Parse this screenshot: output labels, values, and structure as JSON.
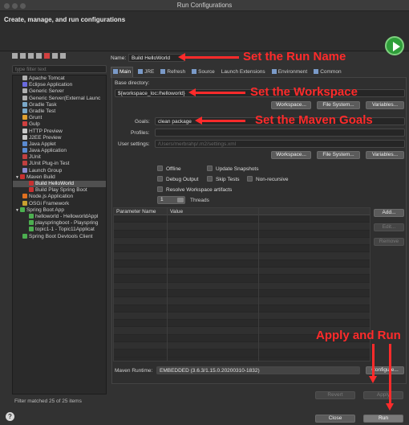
{
  "window": {
    "title": "Run Configurations"
  },
  "header": {
    "title": "Create, manage, and run configurations",
    "run_icon": "run-icon"
  },
  "sidebar": {
    "filter_placeholder": "type filter text",
    "items": [
      {
        "label": "Apache Tomcat",
        "icon": "server-icon",
        "color": "#b0b0b0",
        "indent": 1
      },
      {
        "label": "Eclipse Application",
        "icon": "eclipse-icon",
        "color": "#6a6adf",
        "indent": 1
      },
      {
        "label": "Generic Server",
        "icon": "server-icon",
        "color": "#b0b0b0",
        "indent": 1
      },
      {
        "label": "Generic Server(External Launc",
        "icon": "server-icon",
        "color": "#b0b0b0",
        "indent": 1
      },
      {
        "label": "Gradle Task",
        "icon": "gradle-icon",
        "color": "#7aa8c8",
        "indent": 1
      },
      {
        "label": "Gradle Test",
        "icon": "gradle-icon",
        "color": "#7aa8c8",
        "indent": 1
      },
      {
        "label": "Grunt",
        "icon": "grunt-icon",
        "color": "#e0a030",
        "indent": 1
      },
      {
        "label": "Gulp",
        "icon": "gulp-icon",
        "color": "#d04040",
        "indent": 1
      },
      {
        "label": "HTTP Preview",
        "icon": "preview-icon",
        "color": "#c8c8c8",
        "indent": 1
      },
      {
        "label": "J2EE Preview",
        "icon": "preview-icon",
        "color": "#c8c8c8",
        "indent": 1
      },
      {
        "label": "Java Applet",
        "icon": "applet-icon",
        "color": "#5a8ad0",
        "indent": 1
      },
      {
        "label": "Java Application",
        "icon": "java-icon",
        "color": "#5a8ad0",
        "indent": 1
      },
      {
        "label": "JUnit",
        "icon": "junit-icon",
        "color": "#c04040",
        "indent": 1
      },
      {
        "label": "JUnit Plug-in Test",
        "icon": "junit-icon",
        "color": "#c04040",
        "indent": 1
      },
      {
        "label": "Launch Group",
        "icon": "launch-group-icon",
        "color": "#8a8ad0",
        "indent": 1
      },
      {
        "label": "Maven Build",
        "icon": "maven-icon",
        "color": "#c83030",
        "indent": 0,
        "expanded": true
      },
      {
        "label": "Build HelloWorld",
        "icon": "maven-icon",
        "color": "#c83030",
        "indent": 2,
        "selected": true
      },
      {
        "label": "Build Play Spring Boot",
        "icon": "maven-icon",
        "color": "#c83030",
        "indent": 2
      },
      {
        "label": "Node.js Application",
        "icon": "nodejs-icon",
        "color": "#e07020",
        "indent": 1
      },
      {
        "label": "OSGi Framework",
        "icon": "osgi-icon",
        "color": "#c8a030",
        "indent": 1
      },
      {
        "label": "Spring Boot App",
        "icon": "spring-icon",
        "color": "#4caf50",
        "indent": 0,
        "expanded": true
      },
      {
        "label": "helloworld - HelloworldAppl",
        "icon": "spring-icon",
        "color": "#4caf50",
        "indent": 2
      },
      {
        "label": "playspringboot - Playspring",
        "icon": "spring-icon",
        "color": "#4caf50",
        "indent": 2
      },
      {
        "label": "topic1-1 - Topic11Applicat",
        "icon": "spring-icon",
        "color": "#4caf50",
        "indent": 2
      },
      {
        "label": "Spring Boot Devtools Client",
        "icon": "spring-icon",
        "color": "#4caf50",
        "indent": 1
      }
    ],
    "filter_status": "Filter matched 25 of 25 items"
  },
  "config": {
    "name_label": "Name:",
    "name_value": "Build HelloWorld",
    "tabs": [
      {
        "label": "Main",
        "icon": "main-tab-icon",
        "active": true
      },
      {
        "label": "JRE",
        "icon": "jre-icon"
      },
      {
        "label": "Refresh",
        "icon": "refresh-icon"
      },
      {
        "label": "Source",
        "icon": "source-icon"
      },
      {
        "label": "Launch Extensions",
        "icon": ""
      },
      {
        "label": "Environment",
        "icon": "environment-icon"
      },
      {
        "label": "Common",
        "icon": "common-icon"
      }
    ],
    "base_dir_label": "Base directory:",
    "base_dir_value": "${workspace_loc:/helloworld}",
    "workspace_btn": "Workspace...",
    "filesystem_btn": "File System...",
    "variables_btn": "Variables...",
    "goals_label": "Goals:",
    "goals_value": "clean package",
    "profiles_label": "Profiles:",
    "profiles_value": "",
    "user_settings_label": "User settings:",
    "user_settings_value": "/Users/merbrahp/.m2/settings.xml",
    "options": {
      "offline": "Offline",
      "update_snapshots": "Update Snapshots",
      "debug_output": "Debug Output",
      "skip_tests": "Skip Tests",
      "non_recursive": "Non-recursive",
      "resolve_workspace": "Resolve Workspace artifacts"
    },
    "threads_value": "1",
    "threads_label": "Threads",
    "params_table": {
      "col_name": "Parameter Name",
      "col_value": "Value"
    },
    "add_btn": "Add...",
    "edit_btn": "Edit...",
    "remove_btn": "Remove",
    "runtime_label": "Maven Runtime:",
    "runtime_value": "EMBEDDED (3.6.3/1.15.0.20200310-1832)",
    "configure_btn": "Configure...",
    "revert_btn": "Revert",
    "apply_btn": "Apply"
  },
  "footer": {
    "close_btn": "Close",
    "run_btn": "Run",
    "help": "?"
  },
  "annotations": {
    "run_name": "Set the Run Name",
    "workspace": "Set the Workspace",
    "goals": "Set the Maven Goals",
    "apply_run": "Apply and Run",
    "color": "#ff2b2b"
  }
}
